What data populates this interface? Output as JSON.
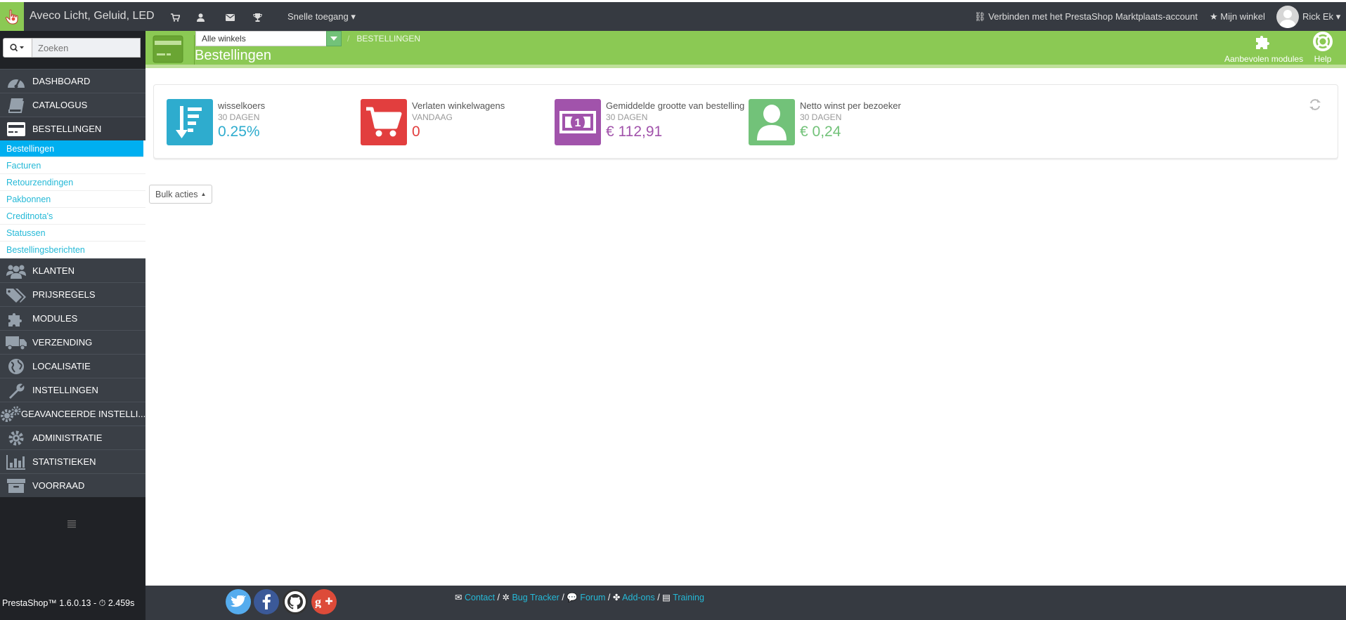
{
  "topbar": {
    "shop_name": "Aveco Licht, Geluid, LED",
    "quick_access": "Snelle toegang",
    "connect": "Verbinden met het PrestaShop Marktplaats-account",
    "my_store": "Mijn winkel",
    "user": "Rick Ek"
  },
  "search": {
    "placeholder": "Zoeken"
  },
  "sidebar": {
    "items": [
      {
        "label": "DASHBOARD",
        "icon": "dashboard-icon"
      },
      {
        "label": "CATALOGUS",
        "icon": "book-icon"
      },
      {
        "label": "BESTELLINGEN",
        "icon": "credit-card-icon"
      },
      {
        "label": "KLANTEN",
        "icon": "users-icon"
      },
      {
        "label": "PRIJSREGELS",
        "icon": "tags-icon"
      },
      {
        "label": "MODULES",
        "icon": "puzzle-icon"
      },
      {
        "label": "VERZENDING",
        "icon": "truck-icon"
      },
      {
        "label": "LOCALISATIE",
        "icon": "globe-icon"
      },
      {
        "label": "INSTELLINGEN",
        "icon": "wrench-icon"
      },
      {
        "label": "GEAVANCEERDE INSTELLI...",
        "icon": "cogs-icon"
      },
      {
        "label": "ADMINISTRATIE",
        "icon": "cog-icon"
      },
      {
        "label": "STATISTIEKEN",
        "icon": "bar-chart-icon"
      },
      {
        "label": "VOORRAAD",
        "icon": "archive-icon"
      }
    ],
    "submenu": [
      "Bestellingen",
      "Facturen",
      "Retourzendingen",
      "Pakbonnen",
      "Creditnota's",
      "Statussen",
      "Bestellingsberichten"
    ]
  },
  "header": {
    "shop_select": "Alle winkels",
    "breadcrumb": "BESTELLINGEN",
    "title": "Bestellingen",
    "recommended": "Aanbevolen modules",
    "help": "Help"
  },
  "kpis": [
    {
      "title": "wisselkoers",
      "sub": "30 DAGEN",
      "value": "0.25%",
      "color": "#2eacce",
      "icon": "sort-amount-down-icon"
    },
    {
      "title": "Verlaten winkelwagens",
      "sub": "VANDAAG",
      "value": "0",
      "color": "#e23e3e",
      "icon": "cart-icon"
    },
    {
      "title": "Gemiddelde grootte van bestelling",
      "sub": "30 DAGEN",
      "value": "€ 112,91",
      "color": "#a153ab",
      "icon": "money-icon"
    },
    {
      "title": "Netto winst per bezoeker",
      "sub": "30 DAGEN",
      "value": "€ 0,24",
      "color": "#72c279",
      "icon": "user-icon"
    }
  ],
  "bulk_actions": "Bulk acties",
  "footer": {
    "version": "PrestaShop™ 1.6.0.13 - ",
    "time": "2.459s",
    "links": [
      "Contact",
      "Bug Tracker",
      "Forum",
      "Add-ons",
      "Training"
    ]
  }
}
